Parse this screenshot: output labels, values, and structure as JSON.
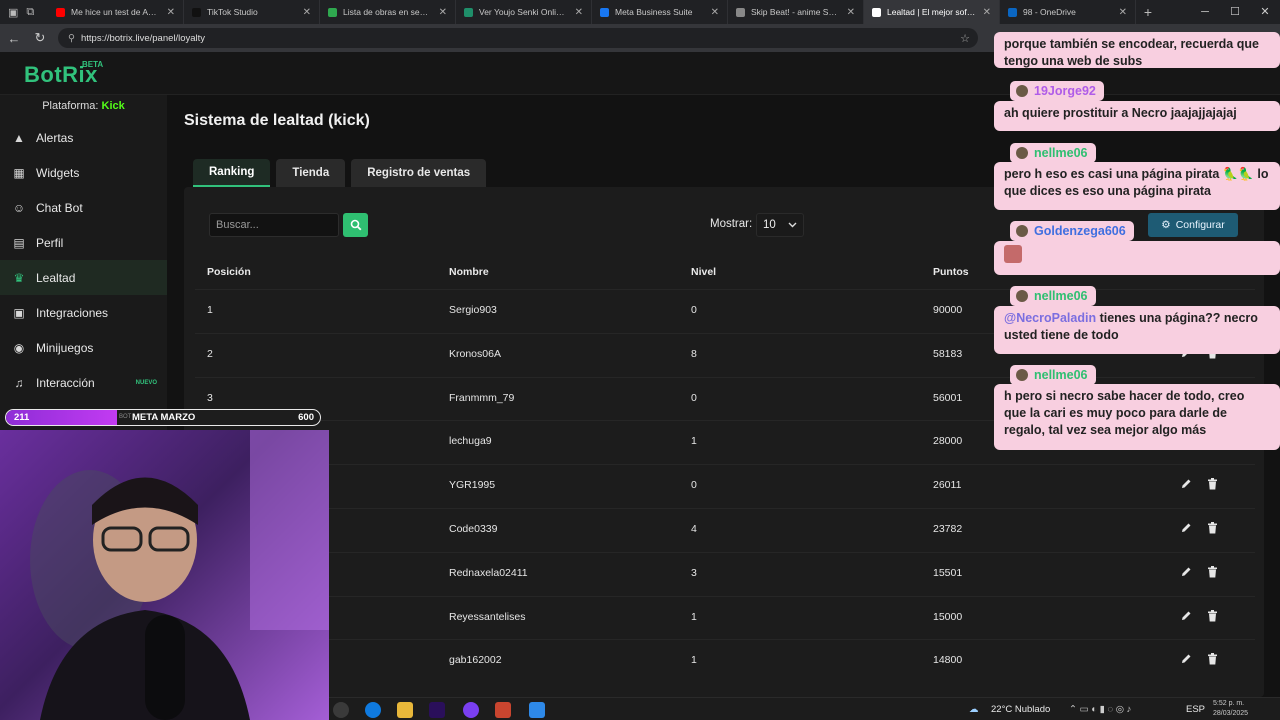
{
  "browser": {
    "tabs": [
      {
        "label": "Me hice un test de ADN pa",
        "color": "#ff0000"
      },
      {
        "label": "TikTok Studio",
        "color": "#111111"
      },
      {
        "label": "Lista de obras en seguimie",
        "color": "#2fa84f"
      },
      {
        "label": "Ver Youjo Senki Online Sub",
        "color": "#1f8f6a"
      },
      {
        "label": "Meta Business Suite",
        "color": "#1877f2"
      },
      {
        "label": "Skip Beat! - anime Skip Be",
        "color": "#888888"
      },
      {
        "label": "Lealtad | El mejor software",
        "color": "#ffffff"
      },
      {
        "label": "98 - OneDrive",
        "color": "#0a66c2"
      }
    ],
    "url": "https://botrix.live/panel/loyalty"
  },
  "site": {
    "logo": "BotRix",
    "logo_badge": "BETA",
    "platform_label": "Plataforma:",
    "platform_value": "Kick"
  },
  "sidebar": {
    "items": [
      {
        "label": "Alertas",
        "icon": "warning-icon"
      },
      {
        "label": "Widgets",
        "icon": "widgets-icon"
      },
      {
        "label": "Chat Bot",
        "icon": "robot-icon"
      },
      {
        "label": "Perfil",
        "icon": "id-card-icon"
      },
      {
        "label": "Lealtad",
        "icon": "trophy-icon",
        "active": true
      },
      {
        "label": "Integraciones",
        "icon": "integrations-icon"
      },
      {
        "label": "Minijuegos",
        "icon": "gamepad-icon"
      },
      {
        "label": "Interacción",
        "icon": "music-icon",
        "badge": "NUEVO"
      }
    ]
  },
  "main": {
    "title": "Sistema de lealtad (kick)",
    "tabs": [
      "Ranking",
      "Tienda",
      "Registro de ventas"
    ],
    "search_placeholder": "Buscar...",
    "show_label": "Mostrar:",
    "show_value": "10",
    "configure_label": "Configurar",
    "columns": [
      "Posición",
      "Nombre",
      "Nivel",
      "Puntos"
    ],
    "rows": [
      {
        "pos": "1",
        "name": "Sergio903",
        "level": "0",
        "points": "90000"
      },
      {
        "pos": "2",
        "name": "Kronos06A",
        "level": "8",
        "points": "58183"
      },
      {
        "pos": "3",
        "name": "Franmmm_79",
        "level": "0",
        "points": "56001"
      },
      {
        "pos": "",
        "name": "lechuga9",
        "level": "1",
        "points": "28000"
      },
      {
        "pos": "",
        "name": "YGR1995",
        "level": "0",
        "points": "26011"
      },
      {
        "pos": "",
        "name": "Code0339",
        "level": "4",
        "points": "23782"
      },
      {
        "pos": "",
        "name": "Rednaxela02411",
        "level": "3",
        "points": "15501"
      },
      {
        "pos": "",
        "name": "Reyessantelises",
        "level": "1",
        "points": "15000"
      },
      {
        "pos": "",
        "name": "gab162002",
        "level": "1",
        "points": "14800"
      }
    ]
  },
  "chat": {
    "messages": [
      {
        "user": "",
        "text": "porque también se encodear, recuerda que tengo una web de subs"
      },
      {
        "user": "19Jorge92",
        "user_color": "#b05ce8",
        "text": "ah quiere prostituir a Necro jaajajjajajaj"
      },
      {
        "user": "nellme06",
        "user_color": "#2fbf71",
        "text": "pero h eso es casi una página pirata 🦜🦜 lo que dices es eso una página pirata"
      },
      {
        "user": "Goldenzega606",
        "user_color": "#3f6fe0",
        "text": ""
      },
      {
        "user": "nellme06",
        "user_color": "#2fbf71",
        "mention": "@NecroPaladin",
        "text": "tienes una página?? necro usted tiene de todo"
      },
      {
        "user": "nellme06",
        "user_color": "#2fbf71",
        "text": "h pero si necro sabe hacer de todo, creo que la cari es muy poco para darle de regalo, tal vez sea mejor algo más"
      }
    ]
  },
  "meta_bar": {
    "current": "211",
    "label": "META MARZO",
    "goal": "600",
    "progress": 0.352,
    "tiny_prefix": "BOT"
  },
  "taskbar": {
    "weather": "22°C  Nublado",
    "lang": "ESP",
    "time": "5:52 p. m.",
    "date": "28/03/2025"
  }
}
